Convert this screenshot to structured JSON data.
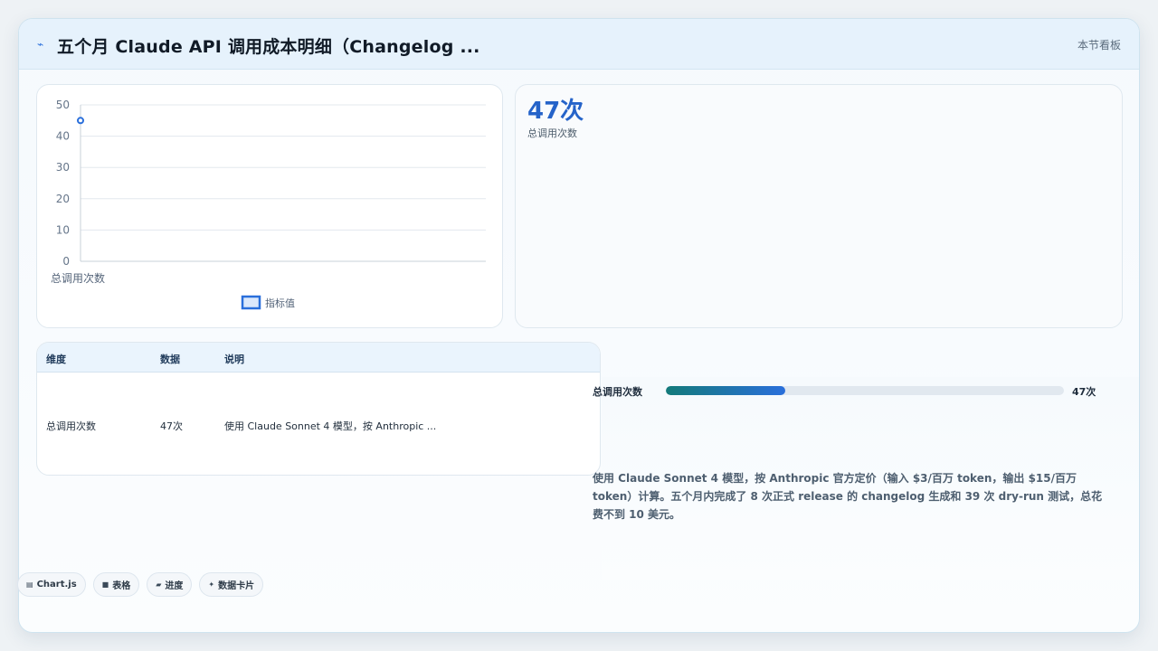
{
  "header": {
    "title": "五个月 Claude API 调用成本明细（Changelog ...",
    "right_link": "本节看板",
    "icon": "sparkline-icon"
  },
  "chart_data": {
    "type": "scatter",
    "categories": [
      "总调用次数"
    ],
    "series": [
      {
        "name": "指标值",
        "values": [
          45
        ]
      }
    ],
    "ylim": [
      0,
      50
    ],
    "yticks": [
      0,
      10,
      20,
      30,
      40,
      50
    ],
    "grid": true,
    "legend": "bottom",
    "colors": {
      "point": "#2a6fdb",
      "grid": "#e3e8ee",
      "axis": "#c8d0d8"
    }
  },
  "metric": {
    "value": "47次",
    "label": "总调用次数"
  },
  "table": {
    "headers": [
      "维度",
      "数据",
      "说明"
    ],
    "rows": [
      [
        "总调用次数",
        "47次",
        "使用 Claude Sonnet 4 模型，按 Anthropic ..."
      ]
    ]
  },
  "progress": {
    "label": "总调用次数",
    "value_text": "47次",
    "fraction": 0.3
  },
  "note": "使用 Claude Sonnet 4 模型，按 Anthropic 官方定价（输入 $3/百万 token，输出 $15/百万 token）计算。五个月内完成了 8 次正式 release 的 changelog 生成和 39 次 dry-run 测试，总花费不到 10 美元。",
  "tags": [
    {
      "icon": "chart-icon",
      "glyph": "▤",
      "label": "Chart.js"
    },
    {
      "icon": "table-icon",
      "glyph": "■",
      "label": "表格"
    },
    {
      "icon": "progress-icon",
      "glyph": "▰",
      "label": "进度"
    },
    {
      "icon": "card-icon",
      "glyph": "✦",
      "label": "数据卡片"
    }
  ]
}
